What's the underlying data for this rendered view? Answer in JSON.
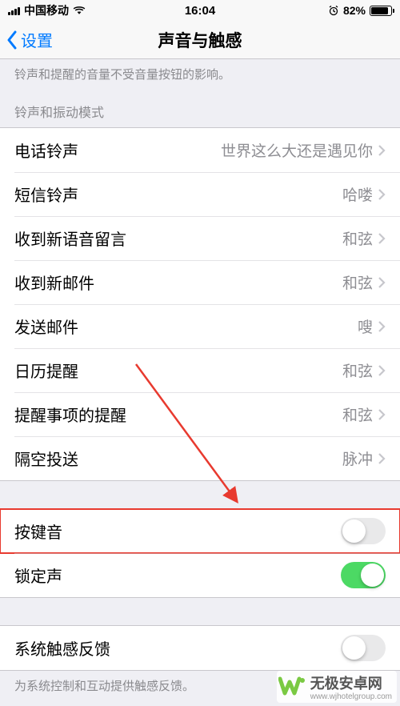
{
  "statusBar": {
    "carrier": "中国移动",
    "time": "16:04",
    "batteryPct": "82%"
  },
  "nav": {
    "back": "设置",
    "title": "声音与触感"
  },
  "topDesc": "铃声和提醒的音量不受音量按钮的影响。",
  "sectionHeader1": "铃声和振动模式",
  "soundRows": [
    {
      "label": "电话铃声",
      "value": "世界这么大还是遇见你"
    },
    {
      "label": "短信铃声",
      "value": "哈喽"
    },
    {
      "label": "收到新语音留言",
      "value": "和弦"
    },
    {
      "label": "收到新邮件",
      "value": "和弦"
    },
    {
      "label": "发送邮件",
      "value": "嗖"
    },
    {
      "label": "日历提醒",
      "value": "和弦"
    },
    {
      "label": "提醒事项的提醒",
      "value": "和弦"
    },
    {
      "label": "隔空投送",
      "value": "脉冲"
    }
  ],
  "toggleRows": [
    {
      "label": "按键音",
      "on": false,
      "highlight": true
    },
    {
      "label": "锁定声",
      "on": true,
      "highlight": false
    }
  ],
  "hapticRows": [
    {
      "label": "系统触感反馈",
      "on": false
    }
  ],
  "hapticFooter": "为系统控制和互动提供触感反馈。",
  "watermark": {
    "title": "无极安卓网",
    "url": "www.wjhotelgroup.com"
  }
}
